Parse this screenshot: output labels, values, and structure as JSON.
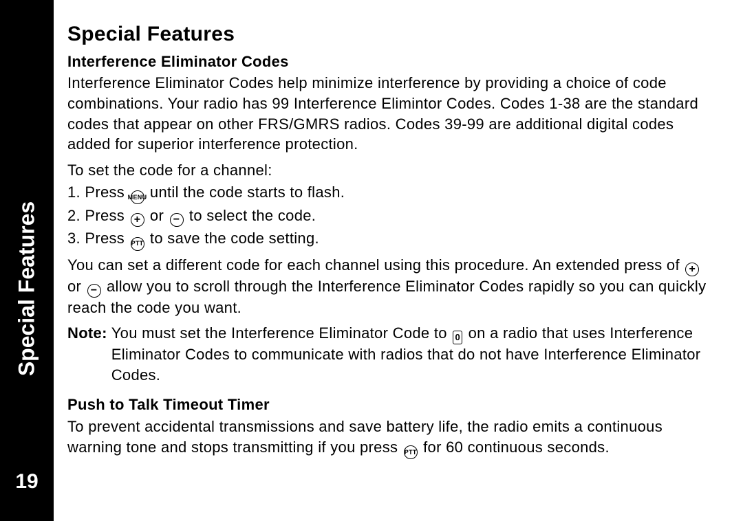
{
  "sidebar": {
    "label": "Special Features",
    "page": "19"
  },
  "title": "Special Features",
  "s1": {
    "heading": "Interference Eliminator Codes",
    "intro": "Interference Eliminator Codes help minimize interference by providing a choice of code combinations. Your radio has 99 Interference Elimintor Codes. Codes 1-38 are the standard codes that appear on other FRS/GMRS radios. Codes 39-99 are additional digital codes added for superior interference protection.",
    "lead": "To set the code for a channel:",
    "step1a": "1. Press ",
    "step1b": " until the code starts to flash.",
    "step2a": "2. Press ",
    "step2or": " or ",
    "step2b": " to select the code.",
    "step3a": "3. Press ",
    "step3b": " to save the code setting.",
    "extA": "You can set a different code for each channel using this procedure. An extended press of ",
    "extOr": " or ",
    "extB": " allow you to scroll through the Interference Eliminator Codes rapidly so you can quickly reach the code you want.",
    "noteLabel": "Note:",
    "noteA": "You must set the Interference Eliminator Code to ",
    "noteB": " on a radio that uses Interference Eliminator Codes to communicate with radios that do not have Interference Eliminator Codes."
  },
  "s2": {
    "heading": "Push to Talk Timeout Timer",
    "textA": "To prevent accidental transmissions and save battery life, the radio emits a continuous warning tone and stops transmitting if you press ",
    "textB": " for 60 continuous seconds."
  },
  "icons": {
    "menu": "MENU",
    "plus": "+",
    "minus": "−",
    "ptt": "PTT",
    "zero": "0"
  }
}
